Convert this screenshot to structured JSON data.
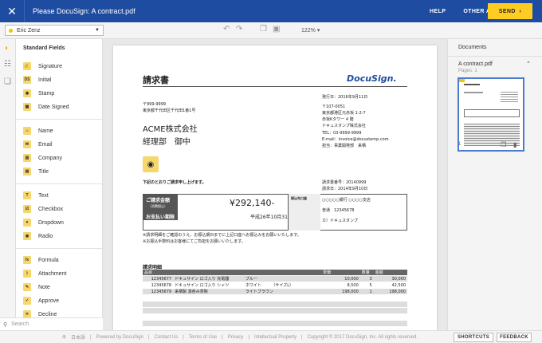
{
  "topbar": {
    "close_icon": "close-icon",
    "title": "Please DocuSign: A contract.pdf",
    "help": "HELP",
    "other_actions": "OTHER ACTIONS",
    "send": "SEND"
  },
  "toolbar": {
    "recipient": "Eric Zenz",
    "zoom": "122%"
  },
  "fields": {
    "heading": "Standard Fields",
    "groups": [
      [
        "Signature",
        "Initial",
        "Stamp",
        "Date Signed"
      ],
      [
        "Name",
        "Email",
        "Company",
        "Title"
      ],
      [
        "Text",
        "Checkbox",
        "Dropdown",
        "Radio"
      ],
      [
        "Formula",
        "Attachment",
        "Note",
        "Approve",
        "Decline"
      ]
    ],
    "search_placeholder": "Search"
  },
  "document": {
    "title": "請求書",
    "logo": "DocuSign.",
    "issue_date": "発行日：2016年9月11日",
    "postal_to": "〒999-9999",
    "address_to": "東京都千代田区千代田1番1号",
    "company_to": "ACME株式会社",
    "dept_to": "経理部　御中",
    "postal_from": "〒107-0051",
    "address_from1": "東京都港区元赤坂 1-2-7",
    "address_from2": "赤坂Kタワー 4 階",
    "company_from": "ドキュスタンプ株式会社",
    "tel": "TEL：03-9999-9999",
    "email": "E-mail：invoice@docustamp.com",
    "person": "担当：事業開発部　来栖",
    "intro": "下記のとおりご請求申し上げます。",
    "invoice_no": "請求書番号：20140999",
    "invoice_date": "請求日：2014年9月10日",
    "amount_label": "ご請求金額",
    "amount_sub": "（消費税込）",
    "amount": "¥292,140-",
    "due_label": "お支払い期限",
    "due": "平成26年10月31日",
    "bank_label": "振込先口座",
    "bank_name": "○○○○○銀行 ○○○○支店",
    "bank_acct": "普通　12345678",
    "bank_holder": "カ）ドキュスタンプ",
    "note1": "※請求明細をご確認のうえ、お振込期日までに上記口座へお振込みをお願いいたします。",
    "note2": "※お振込手数料はお客様にてご負担をお願いいたします。",
    "detail_title": "請求明細",
    "headers": [
      "品目",
      "",
      "",
      "単価",
      "数量",
      "金額"
    ],
    "rows": [
      [
        "12345677",
        "ドキュサイン ロゴ入り 充電器",
        "ブルー",
        "10,000",
        "3",
        "30,000"
      ],
      [
        "12345678",
        "ドキュサイン ロゴ入り シャツ",
        "ホワイト　　　（サイズL）",
        "8,500",
        "5",
        "42,500"
      ],
      [
        "12345679",
        "来栖製 湯呑み茶碗",
        "ライトブラウン",
        "198,000",
        "1",
        "198,000"
      ]
    ]
  },
  "documents_panel": {
    "heading": "Documents",
    "doc_name": "A contract.pdf",
    "pages": "Pages: 1",
    "page_num": "1"
  },
  "footer": {
    "lang": "日本語",
    "links": [
      "Powered by DocuSign",
      "Contact Us",
      "Terms of Use",
      "Privacy",
      "Intellectual Property"
    ],
    "copyright": "Copyright © 2017 DocuSign, Inc. All rights reserved.",
    "shortcuts": "SHORTCUTS",
    "feedback": "FEEDBACK"
  },
  "colors": {
    "topbar": "#1e4ca0",
    "send": "#ffcc22",
    "field_icon": "#f5d76e"
  }
}
